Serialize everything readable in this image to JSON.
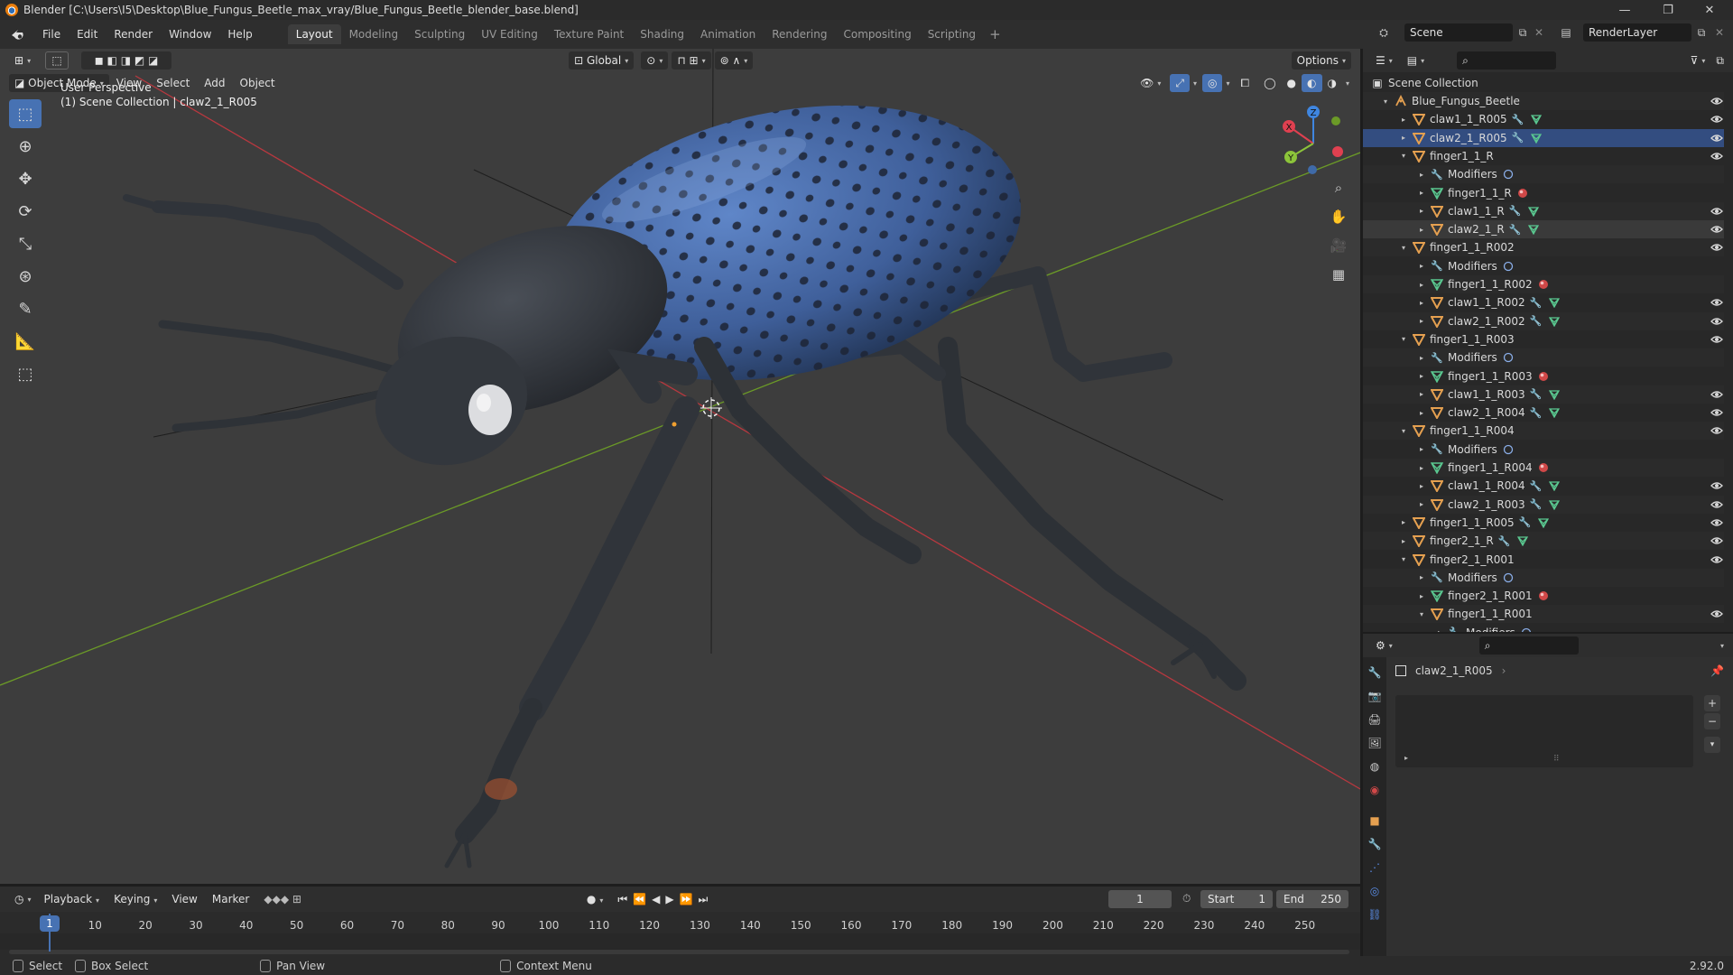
{
  "window": {
    "title": "Blender [C:\\Users\\I5\\Desktop\\Blue_Fungus_Beetle_max_vray/Blue_Fungus_Beetle_blender_base.blend]",
    "minimize": "—",
    "maximize": "❐",
    "close": "✕"
  },
  "menus": [
    "File",
    "Edit",
    "Render",
    "Window",
    "Help"
  ],
  "workspaces": [
    "Layout",
    "Modeling",
    "Sculpting",
    "UV Editing",
    "Texture Paint",
    "Shading",
    "Animation",
    "Rendering",
    "Compositing",
    "Scripting"
  ],
  "workspace_add": "+",
  "scene": {
    "name": "Scene",
    "render_layer": "RenderLayer"
  },
  "viewport": {
    "transform_orientation": "Global",
    "options_label": "Options",
    "mode": "Object Mode",
    "menus": [
      "View",
      "Select",
      "Add",
      "Object"
    ],
    "view_name": "User Perspective",
    "context": "(1) Scene Collection | claw2_1_R005",
    "gizmo_axes": {
      "x": "X",
      "y": "Y",
      "z": "Z"
    },
    "colors": {
      "x_axis": "#e04050",
      "y_axis": "#8cc43a",
      "z_axis": "#3f86e0",
      "grid_x": "#b8383f",
      "grid_y": "#6b9a27"
    }
  },
  "outliner": {
    "root": "Scene Collection",
    "items": [
      {
        "label": "Blue_Fungus_Beetle",
        "type": "armature",
        "depth": 1,
        "expanded": true,
        "eye": true
      },
      {
        "label": "claw1_1_R005",
        "type": "mesh",
        "depth": 2,
        "expanded": false,
        "badges": [
          "wrench",
          "mesh"
        ],
        "eye": true
      },
      {
        "label": "claw2_1_R005",
        "type": "mesh",
        "depth": 2,
        "expanded": false,
        "badges": [
          "wrench",
          "mesh"
        ],
        "eye": true,
        "state": "selected"
      },
      {
        "label": "finger1_1_R",
        "type": "mesh",
        "depth": 2,
        "expanded": true,
        "eye": true
      },
      {
        "label": "Modifiers",
        "type": "modifier",
        "depth": 3,
        "expanded": false,
        "badges": [
          "circle"
        ]
      },
      {
        "label": "finger1_1_R",
        "type": "mesh-data",
        "depth": 3,
        "expanded": false,
        "badges": [
          "material"
        ]
      },
      {
        "label": "claw1_1_R",
        "type": "mesh",
        "depth": 3,
        "expanded": false,
        "badges": [
          "wrench",
          "mesh"
        ],
        "eye": true
      },
      {
        "label": "claw2_1_R",
        "type": "mesh",
        "depth": 3,
        "expanded": false,
        "badges": [
          "wrench",
          "mesh"
        ],
        "eye": true,
        "state": "highlight"
      },
      {
        "label": "finger1_1_R002",
        "type": "mesh",
        "depth": 2,
        "expanded": true,
        "eye": true
      },
      {
        "label": "Modifiers",
        "type": "modifier",
        "depth": 3,
        "expanded": false,
        "badges": [
          "circle"
        ]
      },
      {
        "label": "finger1_1_R002",
        "type": "mesh-data",
        "depth": 3,
        "expanded": false,
        "badges": [
          "material"
        ]
      },
      {
        "label": "claw1_1_R002",
        "type": "mesh",
        "depth": 3,
        "expanded": false,
        "badges": [
          "wrench",
          "mesh"
        ],
        "eye": true
      },
      {
        "label": "claw2_1_R002",
        "type": "mesh",
        "depth": 3,
        "expanded": false,
        "badges": [
          "wrench",
          "mesh"
        ],
        "eye": true
      },
      {
        "label": "finger1_1_R003",
        "type": "mesh",
        "depth": 2,
        "expanded": true,
        "eye": true
      },
      {
        "label": "Modifiers",
        "type": "modifier",
        "depth": 3,
        "expanded": false,
        "badges": [
          "circle"
        ]
      },
      {
        "label": "finger1_1_R003",
        "type": "mesh-data",
        "depth": 3,
        "expanded": false,
        "badges": [
          "material"
        ]
      },
      {
        "label": "claw1_1_R003",
        "type": "mesh",
        "depth": 3,
        "expanded": false,
        "badges": [
          "wrench",
          "mesh"
        ],
        "eye": true
      },
      {
        "label": "claw2_1_R004",
        "type": "mesh",
        "depth": 3,
        "expanded": false,
        "badges": [
          "wrench",
          "mesh"
        ],
        "eye": true
      },
      {
        "label": "finger1_1_R004",
        "type": "mesh",
        "depth": 2,
        "expanded": true,
        "eye": true
      },
      {
        "label": "Modifiers",
        "type": "modifier",
        "depth": 3,
        "expanded": false,
        "badges": [
          "circle"
        ]
      },
      {
        "label": "finger1_1_R004",
        "type": "mesh-data",
        "depth": 3,
        "expanded": false,
        "badges": [
          "material"
        ]
      },
      {
        "label": "claw1_1_R004",
        "type": "mesh",
        "depth": 3,
        "expanded": false,
        "badges": [
          "wrench",
          "mesh"
        ],
        "eye": true
      },
      {
        "label": "claw2_1_R003",
        "type": "mesh",
        "depth": 3,
        "expanded": false,
        "badges": [
          "wrench",
          "mesh"
        ],
        "eye": true
      },
      {
        "label": "finger1_1_R005",
        "type": "mesh",
        "depth": 2,
        "expanded": false,
        "badges": [
          "wrench",
          "mesh"
        ],
        "eye": true
      },
      {
        "label": "finger2_1_R",
        "type": "mesh",
        "depth": 2,
        "expanded": false,
        "badges": [
          "wrench",
          "mesh"
        ],
        "eye": true
      },
      {
        "label": "finger2_1_R001",
        "type": "mesh",
        "depth": 2,
        "expanded": true,
        "eye": true
      },
      {
        "label": "Modifiers",
        "type": "modifier",
        "depth": 3,
        "expanded": false,
        "badges": [
          "circle"
        ]
      },
      {
        "label": "finger2_1_R001",
        "type": "mesh-data",
        "depth": 3,
        "expanded": false,
        "badges": [
          "material"
        ]
      },
      {
        "label": "finger1_1_R001",
        "type": "mesh",
        "depth": 3,
        "expanded": true,
        "eye": true
      },
      {
        "label": "Modifiers",
        "type": "modifier",
        "depth": 4,
        "expanded": false,
        "badges": [
          "circle"
        ]
      }
    ]
  },
  "properties": {
    "object_name": "claw2_1_R005"
  },
  "timeline": {
    "menus": [
      "Playback",
      "Keying",
      "View",
      "Marker"
    ],
    "current_frame": "1",
    "start_label": "Start",
    "start": "1",
    "end_label": "End",
    "end": "250",
    "ticks": [
      "10",
      "20",
      "30",
      "40",
      "50",
      "60",
      "70",
      "80",
      "90",
      "100",
      "110",
      "120",
      "130",
      "140",
      "150",
      "160",
      "170",
      "180",
      "190",
      "200",
      "210",
      "220",
      "230",
      "240",
      "250"
    ],
    "playhead_label": "1"
  },
  "status": {
    "select": "Select",
    "box_select": "Box Select",
    "pan_view": "Pan View",
    "context_menu": "Context Menu",
    "version": "2.92.0"
  },
  "colors": {
    "accent": "#4772b3",
    "selection_row": "#334d80",
    "object_orange": "#e5a050",
    "mesh_green": "#5ac890"
  }
}
